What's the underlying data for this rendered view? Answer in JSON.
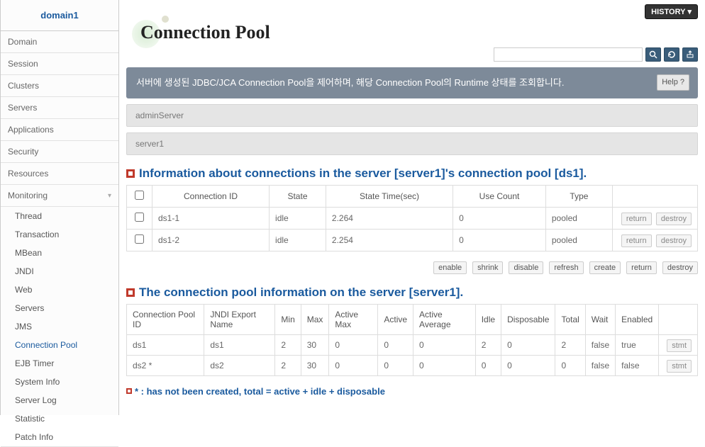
{
  "sidebar": {
    "domain": "domain1",
    "items": [
      "Domain",
      "Session",
      "Clusters",
      "Servers",
      "Applications",
      "Security",
      "Resources"
    ],
    "monitoring_label": "Monitoring",
    "sub": [
      "Thread",
      "Transaction",
      "MBean",
      "JNDI",
      "Web",
      "Servers",
      "JMS",
      "Connection Pool",
      "EJB Timer",
      "System Info",
      "Server Log",
      "Statistic",
      "Patch Info"
    ],
    "active_sub": "Connection Pool"
  },
  "topbar": {
    "history": "HISTORY"
  },
  "page": {
    "title": "Connection Pool",
    "search_placeholder": "",
    "desc": "서버에 생성된 JDBC/JCA Connection Pool을 제어하며, 해당 Connection Pool의 Runtime 상태를 조회합니다.",
    "help": "Help  ?"
  },
  "servers": {
    "admin": "adminServer",
    "s1": "server1"
  },
  "conn_section": {
    "title": "Information about connections in the server [server1]'s connection pool [ds1].",
    "headers": [
      "Connection ID",
      "State",
      "State Time(sec)",
      "Use Count",
      "Type"
    ],
    "rows": [
      {
        "id": "ds1-1",
        "state": "idle",
        "time": "2.264",
        "use": "0",
        "type": "pooled",
        "return": "return",
        "destroy": "destroy"
      },
      {
        "id": "ds1-2",
        "state": "idle",
        "time": "2.254",
        "use": "0",
        "type": "pooled",
        "return": "return",
        "destroy": "destroy"
      }
    ]
  },
  "actions": {
    "enable": "enable",
    "shrink": "shrink",
    "disable": "disable",
    "refresh": "refresh",
    "create": "create",
    "return": "return",
    "destroy": "destroy"
  },
  "pool_section": {
    "title": "The connection pool information on the server [server1].",
    "headers": [
      "Connection Pool ID",
      "JNDI Export Name",
      "Min",
      "Max",
      "Active Max",
      "Active",
      "Active Average",
      "Idle",
      "Disposable",
      "Total",
      "Wait",
      "Enabled",
      ""
    ],
    "rows": [
      {
        "id": "ds1",
        "jndi": "ds1",
        "min": "2",
        "max": "30",
        "amax": "0",
        "active": "0",
        "aavg": "0",
        "idle": "2",
        "disp": "0",
        "total": "2",
        "wait": "false",
        "enabled": "true",
        "btn": "stmt"
      },
      {
        "id": "ds2 *",
        "jndi": "ds2",
        "min": "2",
        "max": "30",
        "amax": "0",
        "active": "0",
        "aavg": "0",
        "idle": "0",
        "disp": "0",
        "total": "0",
        "wait": "false",
        "enabled": "false",
        "btn": "stmt"
      }
    ]
  },
  "footnote": "* : has not been created, total = active + idle + disposable"
}
